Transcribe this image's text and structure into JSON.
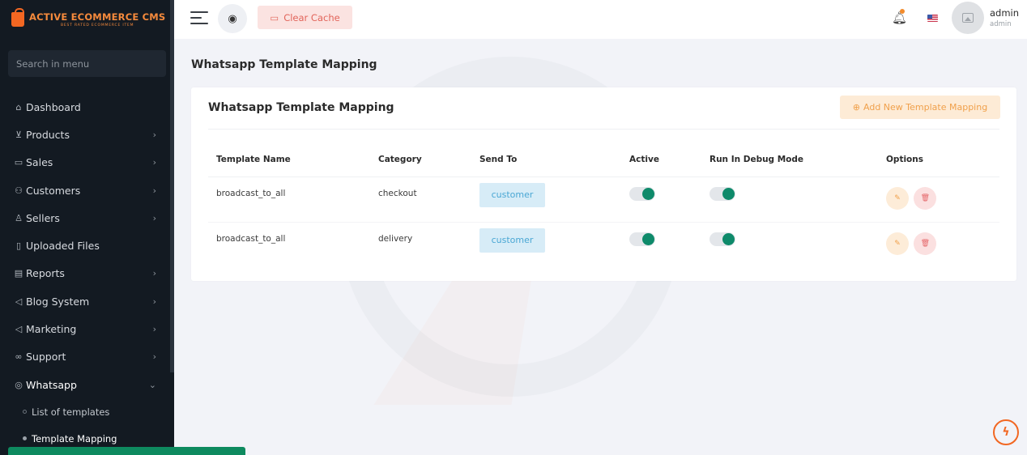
{
  "brand": {
    "name": "ACTIVE ECOMMERCE CMS",
    "tagline": "BEST RATED ECOMMERCE ITEM"
  },
  "sidebar": {
    "search_placeholder": "Search in menu",
    "items": [
      {
        "label": "Dashboard",
        "icon": "home-icon",
        "has_children": false
      },
      {
        "label": "Products",
        "icon": "cart-icon",
        "has_children": true
      },
      {
        "label": "Sales",
        "icon": "money-icon",
        "has_children": true
      },
      {
        "label": "Customers",
        "icon": "users-icon",
        "has_children": true
      },
      {
        "label": "Sellers",
        "icon": "user-icon",
        "has_children": true
      },
      {
        "label": "Uploaded Files",
        "icon": "file-icon",
        "has_children": false
      },
      {
        "label": "Reports",
        "icon": "report-icon",
        "has_children": true
      },
      {
        "label": "Blog System",
        "icon": "megaphone-icon",
        "has_children": true
      },
      {
        "label": "Marketing",
        "icon": "megaphone-icon",
        "has_children": true
      },
      {
        "label": "Support",
        "icon": "link-icon",
        "has_children": true
      },
      {
        "label": "Whatsapp",
        "icon": "whatsapp-icon",
        "has_children": true,
        "open": true
      }
    ],
    "subitems": [
      {
        "label": "List of templates",
        "active": false
      },
      {
        "label": "Template Mapping",
        "active": true
      }
    ]
  },
  "header": {
    "clear_cache_label": "Clear Cache",
    "user": {
      "name": "admin",
      "role": "admin"
    }
  },
  "page": {
    "title": "Whatsapp Template Mapping",
    "card_title": "Whatsapp Template Mapping",
    "add_button_label": "Add New Template Mapping",
    "table": {
      "columns": [
        "Template Name",
        "Category",
        "Send To",
        "Active",
        "Run In Debug Mode",
        "Options"
      ],
      "rows": [
        {
          "template_name": "broadcast_to_all",
          "category": "checkout",
          "send_to": "customer",
          "active": true,
          "debug": true
        },
        {
          "template_name": "broadcast_to_all",
          "category": "delivery",
          "send_to": "customer",
          "active": true,
          "debug": true
        }
      ]
    }
  },
  "colors": {
    "sidebar_bg": "#131a22",
    "accent_orange": "#f26722",
    "toggle_on": "#0e8a6a",
    "badge_blue": "#4aa7d4",
    "clear_cache_red": "#e2645a"
  }
}
